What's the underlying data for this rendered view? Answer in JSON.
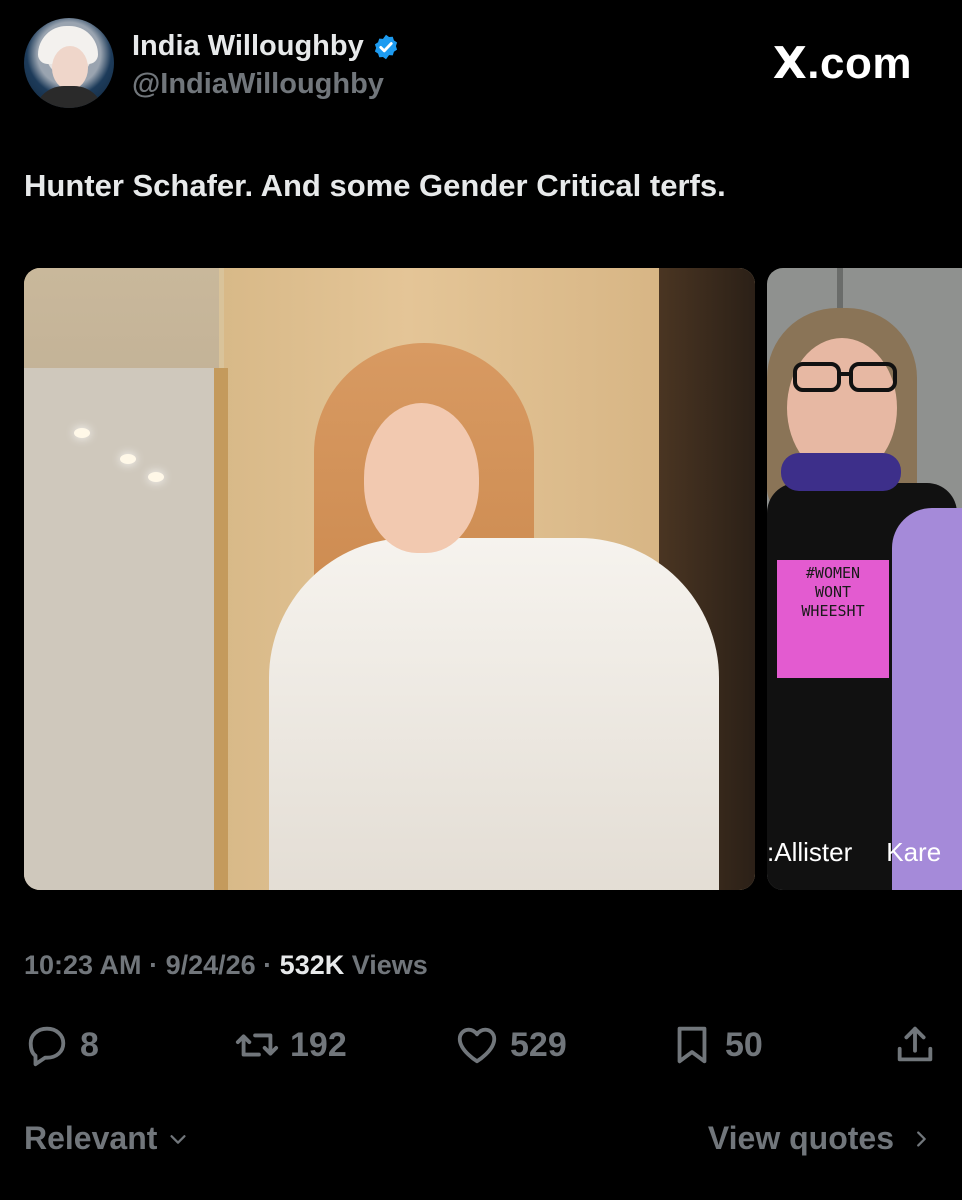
{
  "author": {
    "display_name": "India Willoughby",
    "handle": "@IndiaWilloughby",
    "verified": true
  },
  "brand": {
    "label": ".com",
    "logo": "X"
  },
  "tweet": {
    "text": "Hunter Schafer. And some Gender Critical terfs."
  },
  "media": {
    "second_photo": {
      "sign_lines": [
        "#WOMEN",
        "WONT",
        "WHEESHT"
      ],
      "caption_left": ":Allister",
      "caption_right": "Kare"
    }
  },
  "meta": {
    "time": "10:23 AM",
    "date": "9/24/26",
    "views_count": "532K",
    "views_label": "Views"
  },
  "actions": {
    "replies": "8",
    "reposts": "192",
    "likes": "529",
    "bookmarks": "50"
  },
  "footer": {
    "sort_label": "Relevant",
    "quotes_label": "View quotes"
  },
  "colors": {
    "background": "#000000",
    "primary_text": "#e7e9ea",
    "secondary_text": "#71767b",
    "verified_badge": "#1d9bf0"
  }
}
